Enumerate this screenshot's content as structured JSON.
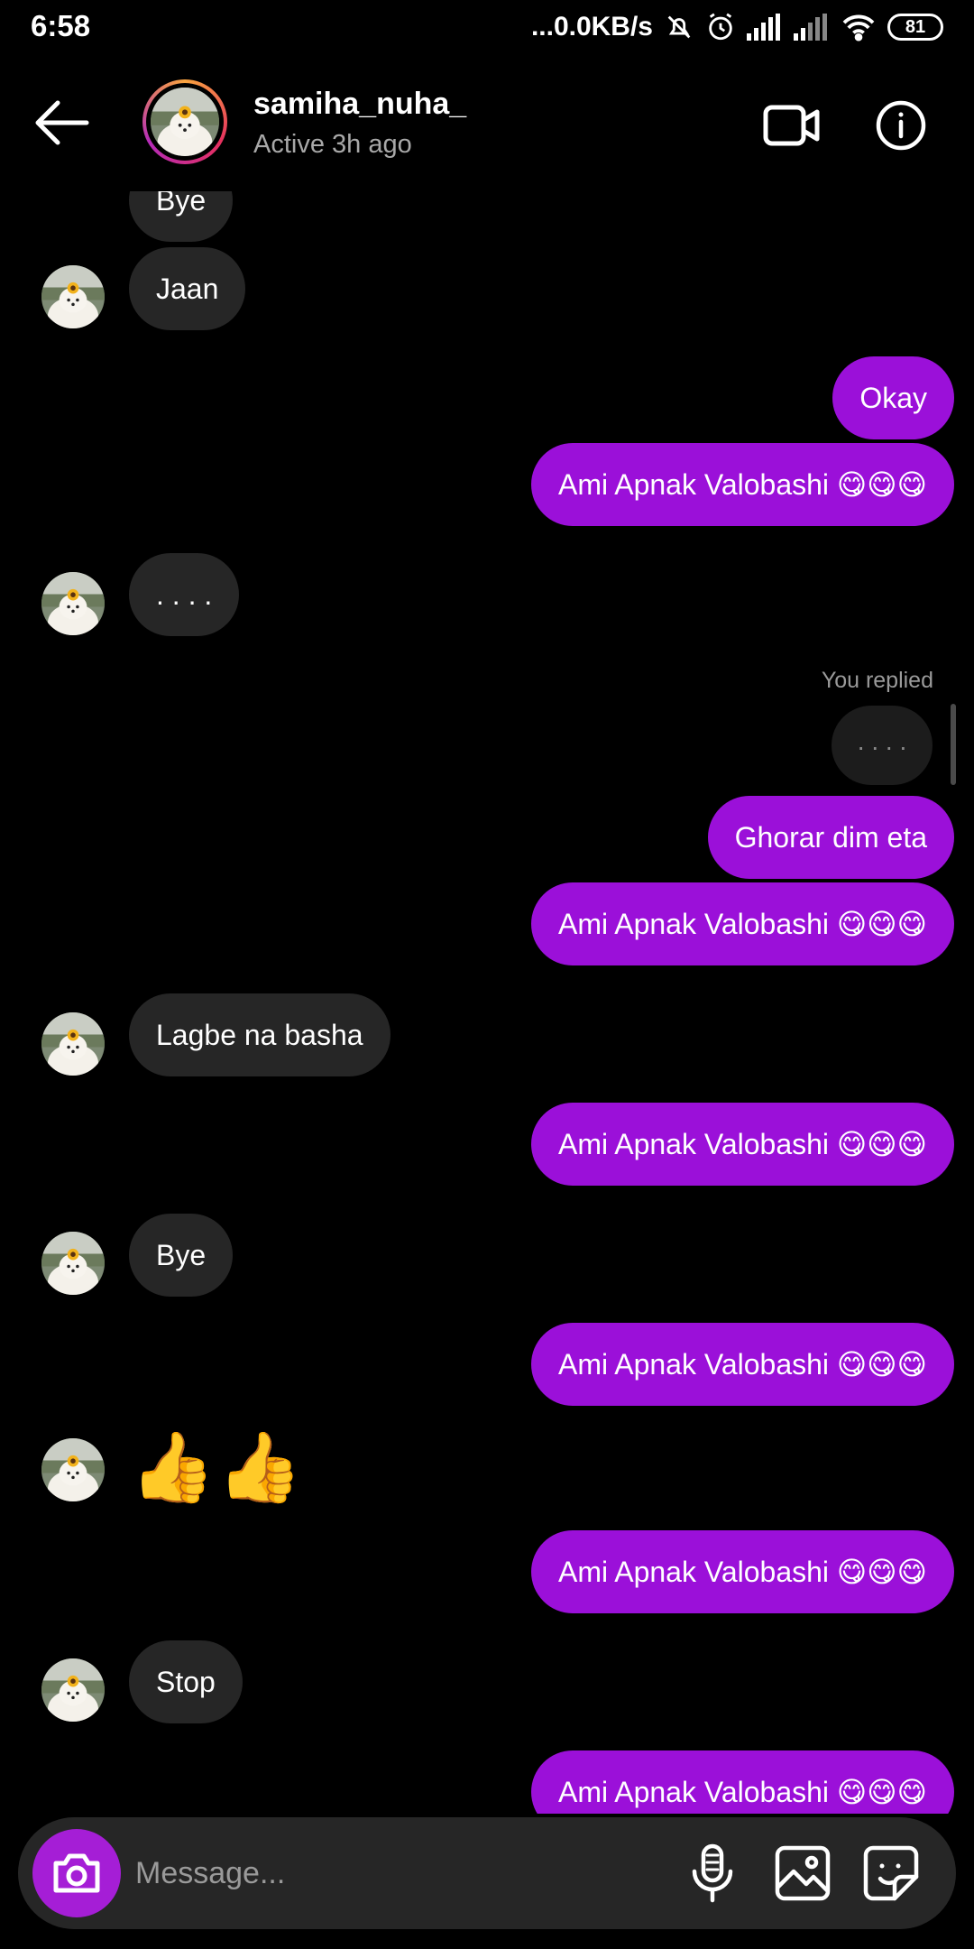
{
  "status_bar": {
    "time": "6:58",
    "network_speed": "...0.0KB/s",
    "battery": "81",
    "icons": [
      "mute-icon",
      "alarm-icon",
      "signal-icon",
      "signal-icon",
      "wifi-icon",
      "battery-icon"
    ]
  },
  "header": {
    "username": "samiha_nuha_",
    "active_status": "Active 3h ago",
    "icons": [
      "back-arrow-icon",
      "video-call-icon",
      "info-icon"
    ]
  },
  "messages": [
    {
      "side": "in",
      "text": "Bye"
    },
    {
      "side": "in",
      "text": "Jaan"
    },
    {
      "side": "out",
      "text": "Okay"
    },
    {
      "side": "out",
      "text": "Ami Apnak Valobashi 😋😋😋"
    },
    {
      "side": "in",
      "text": ". . . ."
    },
    {
      "side": "out_reply_label",
      "text": "You replied"
    },
    {
      "side": "out_reply_quote",
      "text": ". . . ."
    },
    {
      "side": "out",
      "text": "Ghorar dim eta"
    },
    {
      "side": "out",
      "text": "Ami Apnak Valobashi 😋😋😋"
    },
    {
      "side": "in",
      "text": "Lagbe na basha"
    },
    {
      "side": "out",
      "text": "Ami Apnak Valobashi 😋😋😋"
    },
    {
      "side": "in",
      "text": "Bye"
    },
    {
      "side": "out",
      "text": "Ami Apnak Valobashi 😋😋😋"
    },
    {
      "side": "in",
      "text": "👍👍"
    },
    {
      "side": "out",
      "text": "Ami Apnak Valobashi 😋😋😋"
    },
    {
      "side": "in",
      "text": "Stop"
    },
    {
      "side": "out",
      "text": "Ami Apnak Valobashi 😋😋😋"
    }
  ],
  "composer": {
    "placeholder": "Message...",
    "icons": [
      "camera-icon",
      "microphone-icon",
      "gallery-icon",
      "sticker-icon"
    ]
  },
  "colors": {
    "background": "#000000",
    "incoming_bubble": "#262626",
    "outgoing_bubble": "#9b10d9",
    "camera_button": "#a51ed6",
    "secondary_text": "#a8a8a8"
  }
}
